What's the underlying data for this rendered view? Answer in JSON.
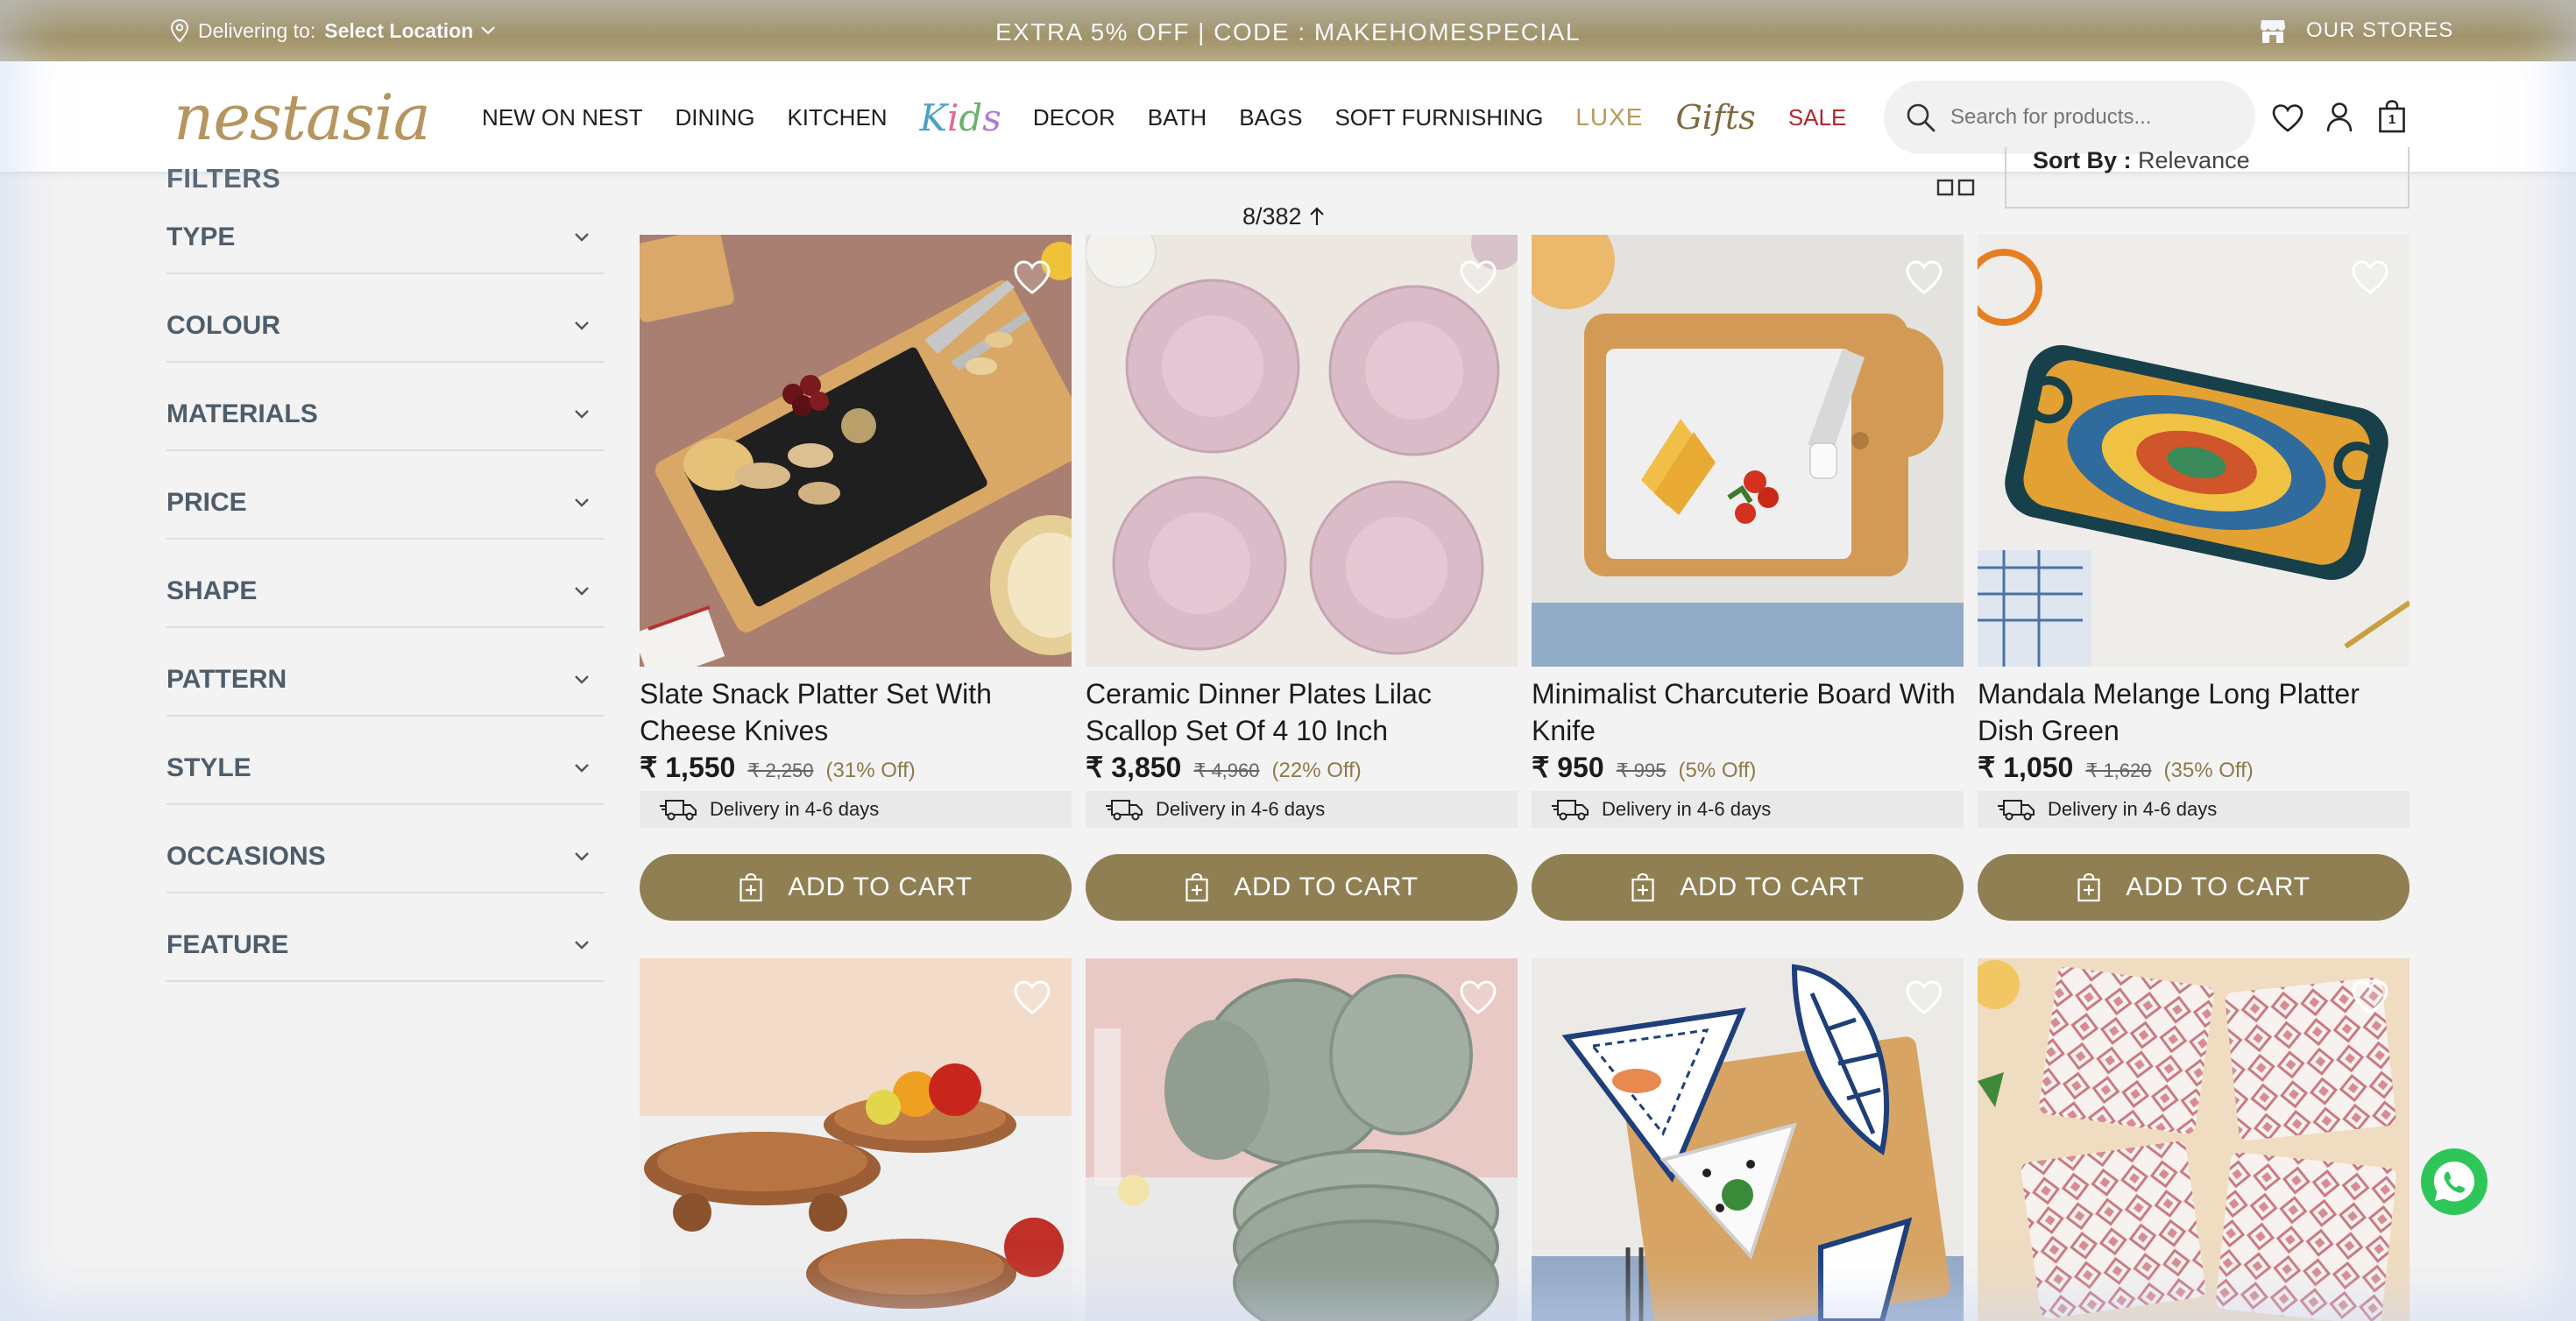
{
  "topbar": {
    "delivering_label": "Delivering to:",
    "location_value": "Select Location",
    "promo": "EXTRA 5% OFF | CODE : MAKEHOMESPECIAL",
    "stores": "OUR STORES"
  },
  "header": {
    "logo": "nestasia",
    "nav": [
      "NEW ON NEST",
      "DINING",
      "KITCHEN",
      "Kids",
      "DECOR",
      "BATH",
      "BAGS",
      "SOFT FURNISHING",
      "LUXE",
      "Gifts",
      "SALE"
    ],
    "search_placeholder": "Search for products...",
    "cart_count": "1"
  },
  "sidebar": {
    "title": "FILTERS",
    "filters": [
      "TYPE",
      "COLOUR",
      "MATERIALS",
      "PRICE",
      "SHAPE",
      "PATTERN",
      "STYLE",
      "OCCASIONS",
      "FEATURE"
    ]
  },
  "listing": {
    "count": "8/382",
    "sort_label": "Sort By :",
    "sort_value": "Relevance",
    "delivery_text": "Delivery in 4-6 days",
    "cart_label": "ADD TO CART"
  },
  "products": [
    {
      "name": "Slate Snack Platter Set With Cheese Knives",
      "price": "₹ 1,550",
      "mrp": "₹ 2,250",
      "off": "(31% Off)"
    },
    {
      "name": "Ceramic Dinner Plates Lilac Scallop Set Of 4 10 Inch",
      "price": "₹ 3,850",
      "mrp": "₹ 4,960",
      "off": "(22% Off)"
    },
    {
      "name": "Minimalist Charcuterie Board With Knife",
      "price": "₹ 950",
      "mrp": "₹ 995",
      "off": "(5% Off)"
    },
    {
      "name": "Mandala Melange Long Platter Dish Green",
      "price": "₹ 1,050",
      "mrp": "₹ 1,620",
      "off": "(35% Off)"
    }
  ],
  "colors": {
    "accent": "#8f7f52",
    "sale": "#b3262d",
    "topbar": "#a79561"
  }
}
